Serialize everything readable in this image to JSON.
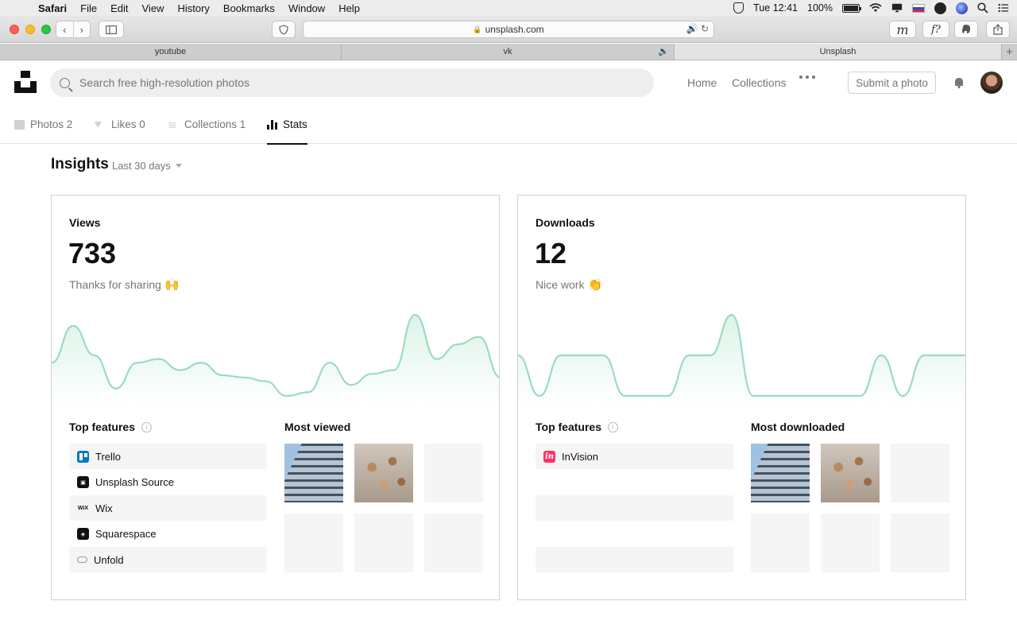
{
  "menubar": {
    "app": "Safari",
    "items": [
      "File",
      "Edit",
      "View",
      "History",
      "Bookmarks",
      "Window",
      "Help"
    ],
    "clock": "Tue 12:41",
    "battery": "100%"
  },
  "browser": {
    "url": "unsplash.com",
    "tabs": [
      "youtube",
      "vk",
      "Unsplash"
    ],
    "ext1": "m",
    "ext2": "f?"
  },
  "header": {
    "search_placeholder": "Search free high-resolution photos",
    "nav_home": "Home",
    "nav_collections": "Collections",
    "submit_label": "Submit a photo"
  },
  "profile_tabs": {
    "photos": "Photos 2",
    "likes": "Likes 0",
    "collections": "Collections 1",
    "stats": "Stats"
  },
  "insights": {
    "title": "Insights",
    "range": "Last 30 days"
  },
  "views_card": {
    "label": "Views",
    "value": "733",
    "subtitle": "Thanks for sharing",
    "emoji": "🙌",
    "features_title": "Top features",
    "features": [
      "Trello",
      "Unsplash Source",
      "Wix",
      "Squarespace",
      "Unfold"
    ],
    "media_title": "Most viewed",
    "chart_color": "#9bdcbf"
  },
  "downloads_card": {
    "label": "Downloads",
    "value": "12",
    "subtitle": "Nice work",
    "emoji": "👏",
    "features_title": "Top features",
    "features": [
      "InVision"
    ],
    "media_title": "Most downloaded",
    "chart_color": "#9bdcbf"
  },
  "chart_data": [
    {
      "type": "area",
      "series_views": [
        0.45,
        0.95,
        0.55,
        0.1,
        0.45,
        0.5,
        0.35,
        0.45,
        0.28,
        0.25,
        0.2,
        0.0,
        0.05,
        0.45,
        0.15,
        0.3,
        0.35,
        1.1,
        0.5,
        0.7,
        0.8,
        0.25
      ]
    },
    {
      "type": "area",
      "series_downloads": [
        0.5,
        0.0,
        0.5,
        0.5,
        0.5,
        0.0,
        0.0,
        0.0,
        0.5,
        0.5,
        1.0,
        0.0,
        0.0,
        0.0,
        0.0,
        0.0,
        0.0,
        0.5,
        0.0,
        0.5,
        0.5,
        0.5
      ]
    }
  ]
}
